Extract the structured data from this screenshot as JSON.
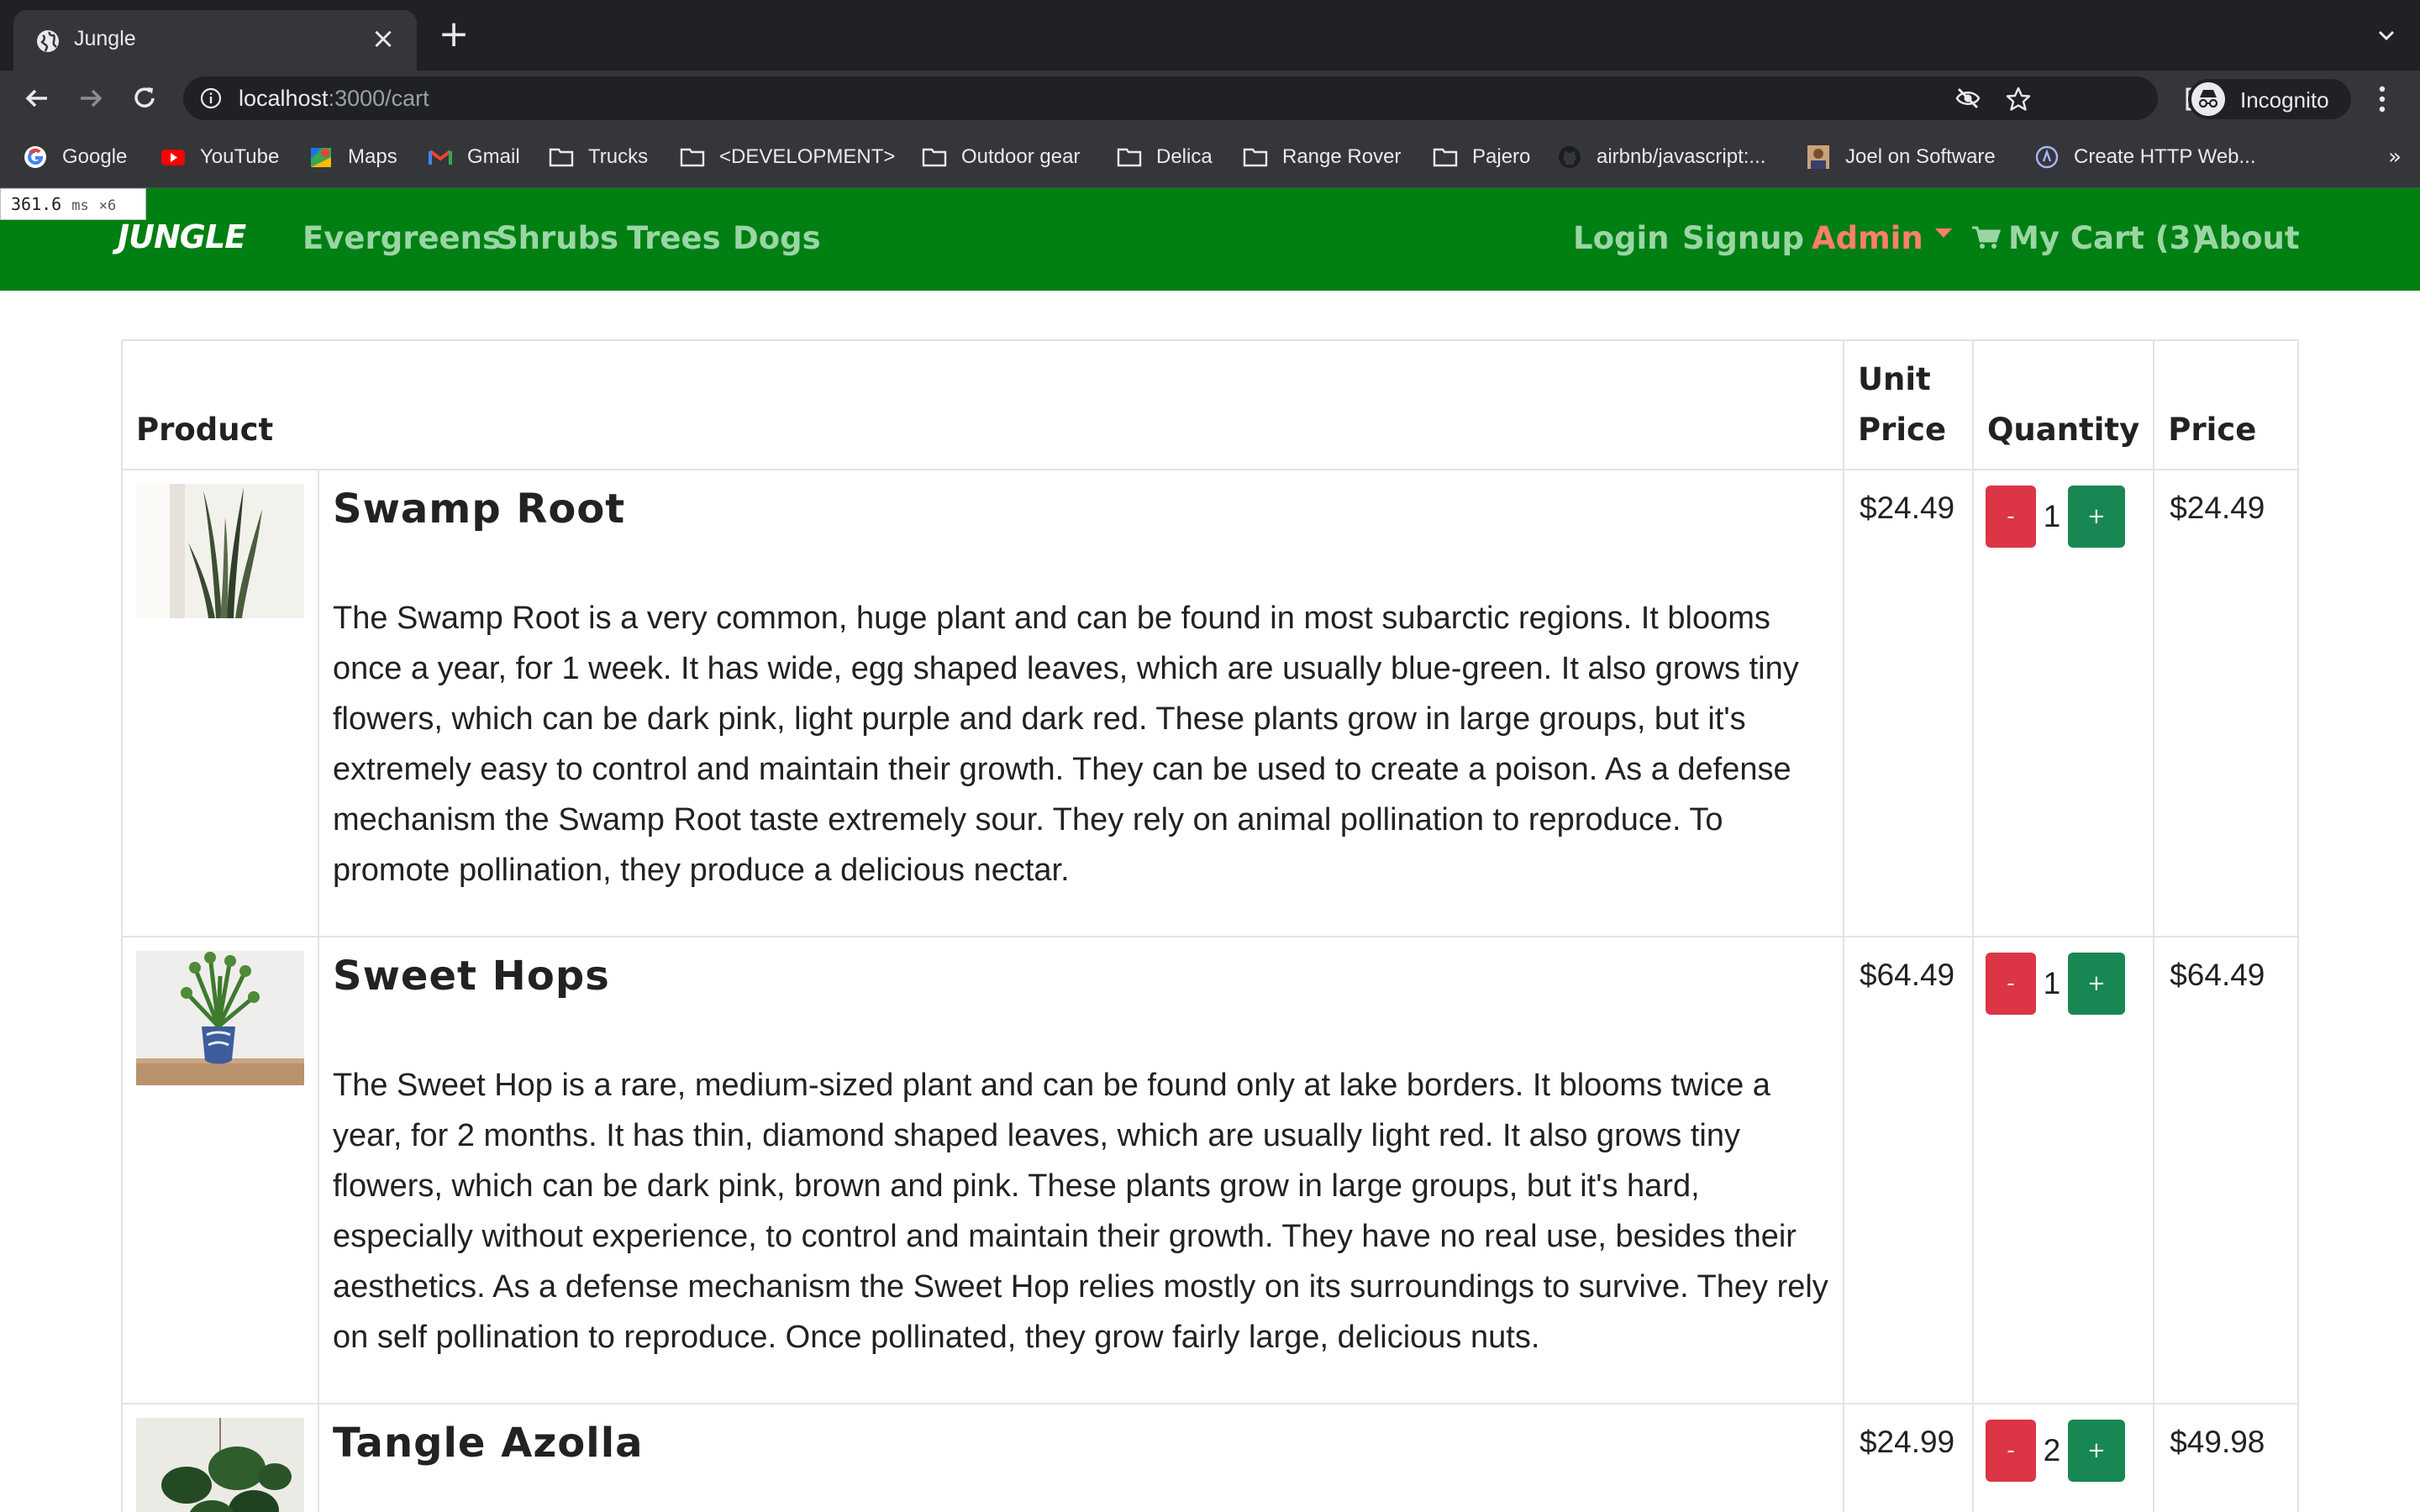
{
  "browser": {
    "tab_title": "Jungle",
    "url_host": "localhost",
    "url_rest": ":3000/cart",
    "profile_label": "Incognito",
    "bookmarks": [
      {
        "label": "Google",
        "icon": "google-icon"
      },
      {
        "label": "YouTube",
        "icon": "youtube-icon"
      },
      {
        "label": "Maps",
        "icon": "maps-icon"
      },
      {
        "label": "Gmail",
        "icon": "gmail-icon"
      },
      {
        "label": "Trucks",
        "icon": "folder-icon"
      },
      {
        "label": "<DEVELOPMENT>",
        "icon": "folder-icon"
      },
      {
        "label": "Outdoor gear",
        "icon": "folder-icon"
      },
      {
        "label": "Delica",
        "icon": "folder-icon"
      },
      {
        "label": "Range Rover",
        "icon": "folder-icon"
      },
      {
        "label": "Pajero",
        "icon": "folder-icon"
      },
      {
        "label": "airbnb/javascript:...",
        "icon": "github-icon"
      },
      {
        "label": "Joel on Software",
        "icon": "avatar-icon"
      },
      {
        "label": "Create HTTP Web...",
        "icon": "app-icon"
      }
    ],
    "more_label": "»"
  },
  "perf": {
    "value": "361.6",
    "unit": "ms",
    "mult": "×6"
  },
  "nav": {
    "brand": "JUNGLE",
    "left": [
      "Evergreens",
      "Shrubs",
      "Trees",
      "Dogs"
    ],
    "login": "Login",
    "signup": "Signup",
    "admin": "Admin",
    "cart": "My Cart (3)",
    "about": "About"
  },
  "colors": {
    "nav_bg": "#007f13",
    "nav_link": "#9ad6a4",
    "admin": "#ff7f6d",
    "minus": "#dc3545",
    "plus": "#198754"
  },
  "table": {
    "headers": {
      "product": "Product",
      "unit_price": "Unit Price",
      "quantity": "Quantity",
      "price": "Price"
    },
    "rows": [
      {
        "name": "Swamp Root",
        "description": "The Swamp Root is a very common, huge plant and can be found in most subarctic regions. It blooms once a year, for 1 week. It has wide, egg shaped leaves, which are usually blue-green. It also grows tiny flowers, which can be dark pink, light purple and dark red. These plants grow in large groups, but it's extremely easy to control and maintain their growth. They can be used to create a poison. As a defense mechanism the Swamp Root taste extremely sour. They rely on animal pollination to reproduce. To promote pollination, they produce a delicious nectar.",
        "unit_price": "$24.49",
        "quantity": "1",
        "price": "$24.49"
      },
      {
        "name": "Sweet Hops",
        "description": "The Sweet Hop is a rare, medium-sized plant and can be found only at lake borders. It blooms twice a year, for 2 months. It has thin, diamond shaped leaves, which are usually light red. It also grows tiny flowers, which can be dark pink, brown and pink. These plants grow in large groups, but it's hard, especially without experience, to control and maintain their growth. They have no real use, besides their aesthetics. As a defense mechanism the Sweet Hop relies mostly on its surroundings to survive. They rely on self pollination to reproduce. Once pollinated, they grow fairly large, delicious nuts.",
        "unit_price": "$64.49",
        "quantity": "1",
        "price": "$64.49"
      },
      {
        "name": "Tangle Azolla",
        "description": "",
        "unit_price": "$24.99",
        "quantity": "2",
        "price": "$49.98"
      }
    ],
    "minus_label": "-",
    "plus_label": "+"
  }
}
